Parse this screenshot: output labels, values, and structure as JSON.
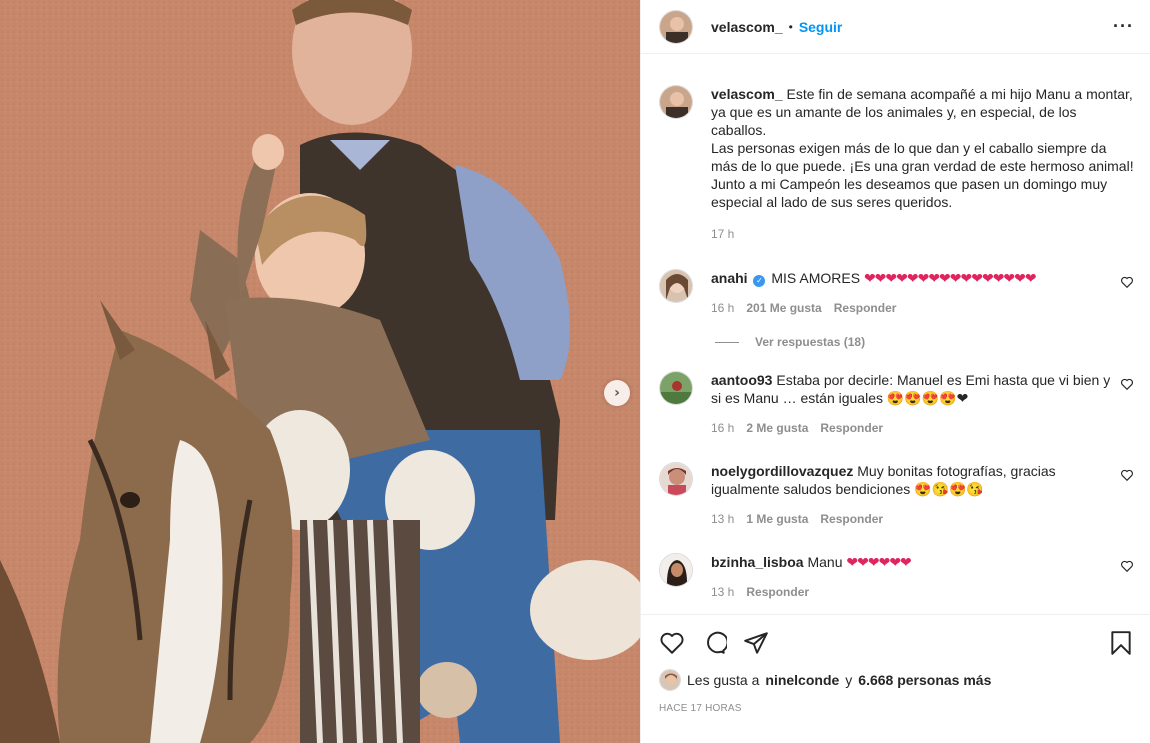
{
  "photo": {
    "alt": "",
    "next_icon": "chevron-right-icon"
  },
  "header": {
    "username": "velascom_",
    "follow_label": "Seguir",
    "more_icon": "more-icon"
  },
  "caption": {
    "username": "velascom_",
    "text_lines": [
      "Este fin de semana acompañé a mi hijo Manu a montar, ya que es un amante de los animales y, en especial, de los caballos.",
      "Las personas exigen más de lo que dan y el caballo siempre da más de lo que puede. ¡Es una gran verdad de este hermoso animal!",
      "Junto a mi Campeón les deseamos que pasen un domingo muy especial al lado de sus seres queridos."
    ],
    "time": "17 h"
  },
  "comments": [
    {
      "username": "anahi",
      "verified": true,
      "text": "MIS AMORES",
      "emoji": "❤❤❤❤❤❤❤❤❤❤❤❤❤❤❤❤",
      "time": "16 h",
      "likes": "201 Me gusta",
      "reply": "Responder",
      "replies_label": "Ver respuestas (18)"
    },
    {
      "username": "aantoo93",
      "text": "Estaba por decirle: Manuel es Emi hasta que vi bien y si es Manu … están iguales",
      "emoji": "😍😍😍😍❤",
      "time": "16 h",
      "likes": "2 Me gusta",
      "reply": "Responder"
    },
    {
      "username": "noelygordillovazquez",
      "text": "Muy bonitas fotografías, gracias igualmente saludos bendiciones",
      "emoji": "😍😘😍😘",
      "time": "13 h",
      "likes": "1 Me gusta",
      "reply": "Responder"
    },
    {
      "username": "bzinha_lisboa",
      "text": "Manu",
      "emoji": "❤❤❤❤❤❤",
      "time": "13 h",
      "likes": "",
      "reply": "Responder"
    }
  ],
  "actions": {
    "icons": [
      "heart-icon",
      "comment-icon",
      "share-icon",
      "bookmark-icon"
    ],
    "liked_by_prefix": "Les gusta a",
    "liked_by_user": "ninelconde",
    "liked_by_and": "y",
    "liked_by_others": "6.668 personas más",
    "timestamp": "Hace 17 horas"
  },
  "colors": {
    "link": "#0095f6",
    "secondary": "#8e8e8e",
    "heart": "#e0245e",
    "wall": "#c8876a"
  }
}
